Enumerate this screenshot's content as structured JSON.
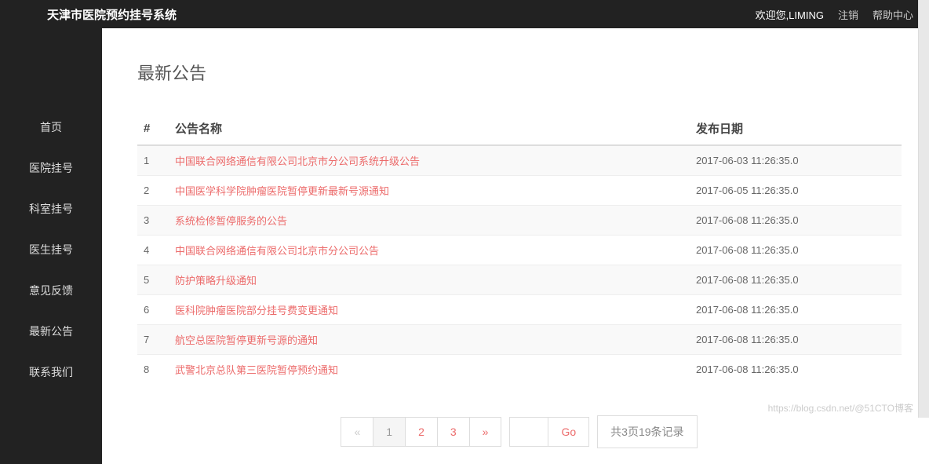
{
  "header": {
    "title": "天津市医院预约挂号系统",
    "welcome": "欢迎您,LIMING",
    "logout": "注销",
    "help": "帮助中心"
  },
  "sidebar": {
    "items": [
      {
        "label": "首页"
      },
      {
        "label": "医院挂号"
      },
      {
        "label": "科室挂号"
      },
      {
        "label": "医生挂号"
      },
      {
        "label": "意见反馈"
      },
      {
        "label": "最新公告"
      },
      {
        "label": "联系我们"
      }
    ]
  },
  "main": {
    "title": "最新公告",
    "columns": {
      "idx": "#",
      "name": "公告名称",
      "date": "发布日期"
    },
    "rows": [
      {
        "idx": "1",
        "name": "中国联合网络通信有限公司北京市分公司系统升级公告",
        "date": "2017-06-03 11:26:35.0"
      },
      {
        "idx": "2",
        "name": "中国医学科学院肿瘤医院暂停更新最新号源通知",
        "date": "2017-06-05 11:26:35.0"
      },
      {
        "idx": "3",
        "name": "系统检修暂停服务的公告",
        "date": "2017-06-08 11:26:35.0"
      },
      {
        "idx": "4",
        "name": "中国联合网络通信有限公司北京市分公司公告",
        "date": "2017-06-08 11:26:35.0"
      },
      {
        "idx": "5",
        "name": "防护策略升级通知",
        "date": "2017-06-08 11:26:35.0"
      },
      {
        "idx": "6",
        "name": "医科院肿瘤医院部分挂号费变更通知",
        "date": "2017-06-08 11:26:35.0"
      },
      {
        "idx": "7",
        "name": "航空总医院暂停更新号源的通知",
        "date": "2017-06-08 11:26:35.0"
      },
      {
        "idx": "8",
        "name": "武警北京总队第三医院暂停预约通知",
        "date": "2017-06-08 11:26:35.0"
      }
    ]
  },
  "pagination": {
    "prev": "«",
    "pages": [
      "1",
      "2",
      "3"
    ],
    "next": "»",
    "go": "Go",
    "info": "共3页19条记录",
    "current": "1"
  },
  "watermark": "https://blog.csdn.net/@51CTO博客"
}
